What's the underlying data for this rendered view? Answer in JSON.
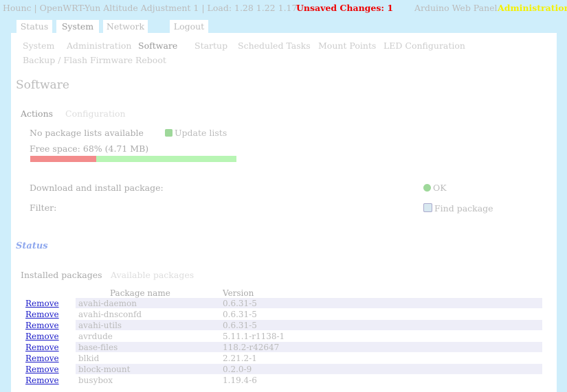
{
  "topbar": {
    "host": "Hounc | OpenWRT-Yun Altitude Adjustment 1 | Load: 1.28 1.22 1.17",
    "unsaved": "Unsaved Changes: 1",
    "web_panel": "Arduino Web Panel",
    "admin": "Administration"
  },
  "tabs": [
    "Status",
    "System",
    "Network",
    "Logout"
  ],
  "subnav": {
    "row1": [
      "System",
      "Administration",
      "Software",
      "Startup",
      "Scheduled Tasks",
      "Mount Points",
      "LED Configuration"
    ],
    "row2": [
      "Backup / Flash Firmware",
      "Reboot"
    ]
  },
  "page_title": "Software",
  "content_tabs": [
    "Actions",
    "Configuration"
  ],
  "actions": {
    "no_lists": "No package lists available",
    "update_lists": "Update lists",
    "free_space": "Free space: 68% (4.71 MB)",
    "free_space_fraction": 0.68,
    "download_label": "Download and install package:",
    "ok": "OK",
    "filter_label": "Filter:",
    "find_package": "Find package"
  },
  "status_title": "Status",
  "package_tabs": [
    "Installed packages",
    "Available packages"
  ],
  "table": {
    "headers": [
      "Package name",
      "Version"
    ],
    "remove_label": "Remove",
    "rows": [
      [
        "avahi-daemon",
        "0.6.31-5"
      ],
      [
        "avahi-dnsconfd",
        "0.6.31-5"
      ],
      [
        "avahi-utils",
        "0.6.31-5"
      ],
      [
        "avrdude",
        "5.11.1-r1138-1"
      ],
      [
        "base-files",
        "118.2-r42647"
      ],
      [
        "blkid",
        "2.21.2-1"
      ],
      [
        "block-mount",
        "0.2.0-9"
      ],
      [
        "busybox",
        "1.19.4-6"
      ]
    ]
  },
  "colors": {
    "background": "#cfeefb",
    "unsaved": "#ee0000",
    "admin": "#f5f000",
    "status_title": "#8fa8ee",
    "bar_used": "#f38c8c",
    "bar_free": "#b8f5b4",
    "link": "#1a1ac8"
  }
}
